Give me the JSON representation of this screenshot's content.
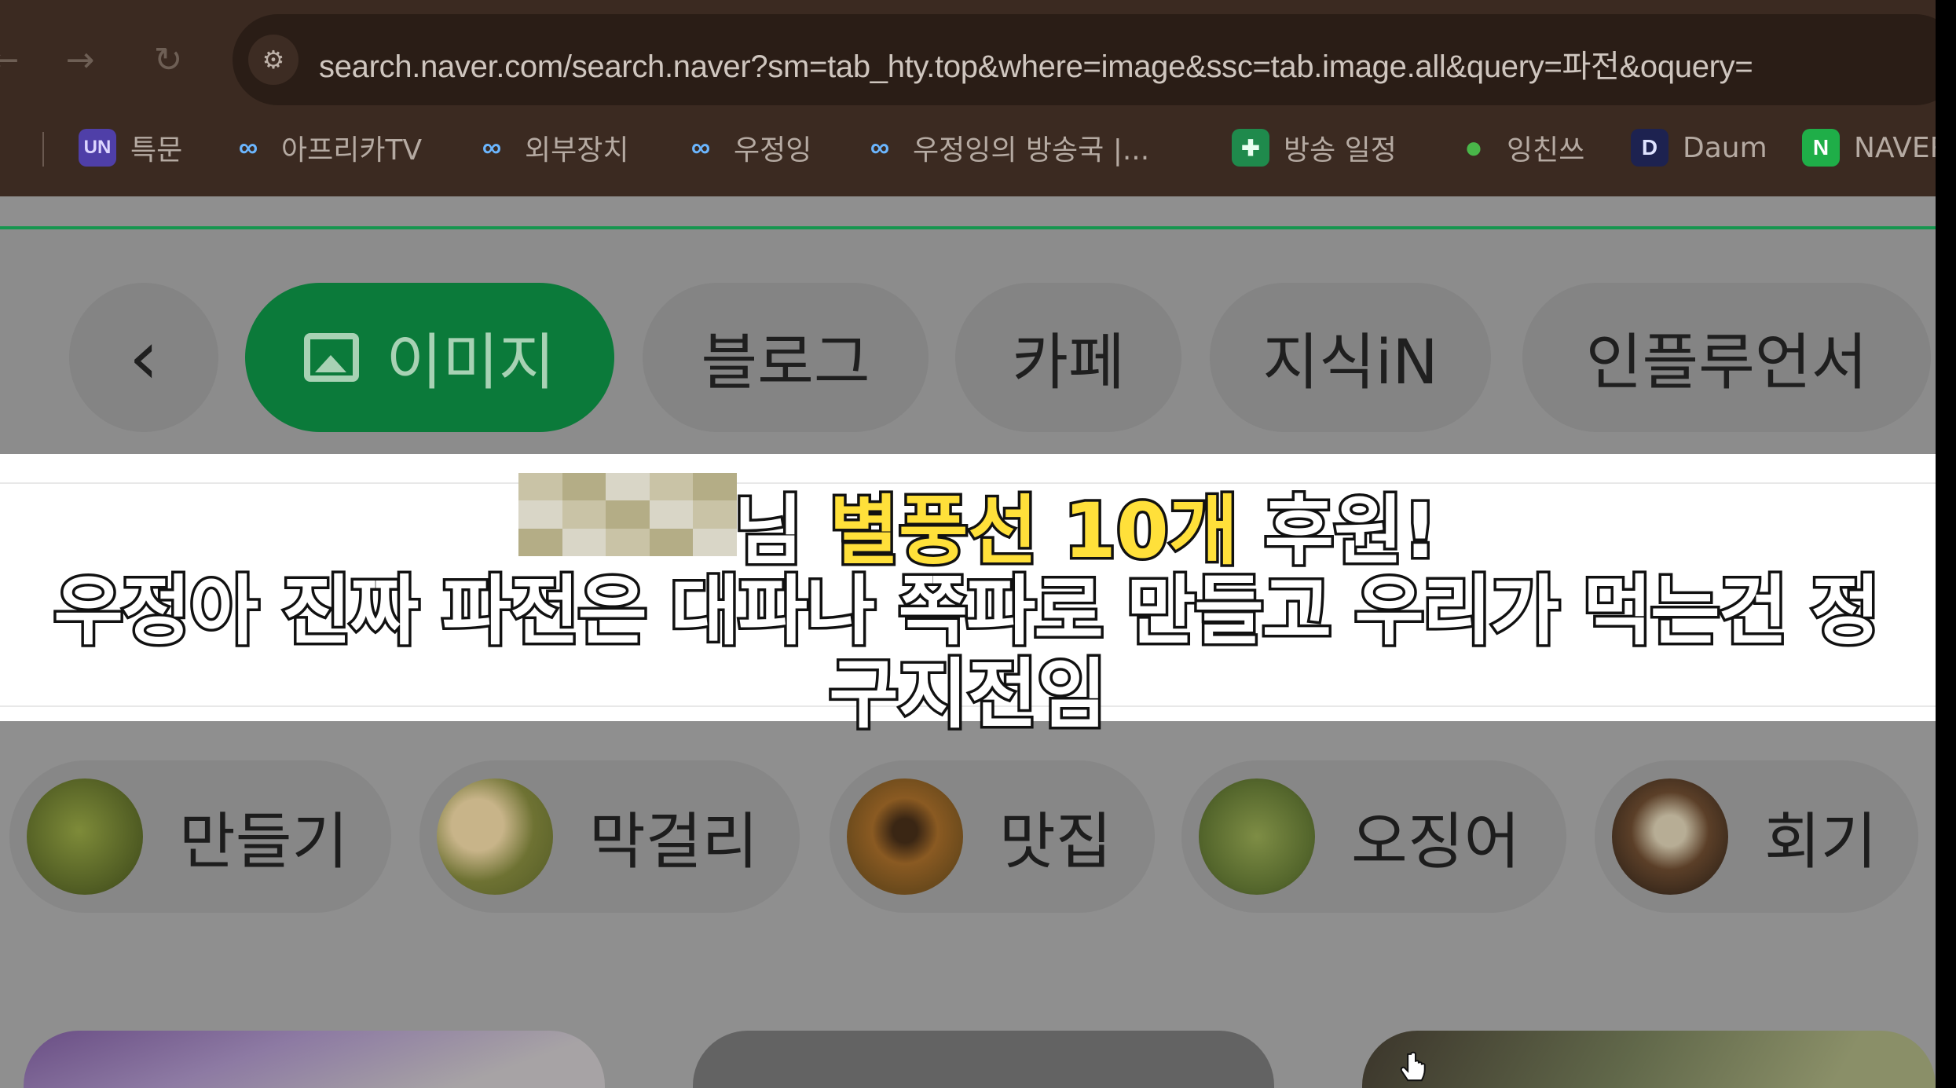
{
  "browser": {
    "url": "search.naver.com/search.naver?sm=tab_hty.top&where=image&ssc=tab.image.all&query=파전&oquery=",
    "bookmarks": [
      {
        "label": "특문",
        "icon": "UN"
      },
      {
        "label": "아프리카TV",
        "icon": "afreecatv-icon"
      },
      {
        "label": "외부장치",
        "icon": "afreecatv-icon"
      },
      {
        "label": "우정잉",
        "icon": "afreecatv-icon"
      },
      {
        "label": "우정잉의 방송국 |...",
        "icon": "afreecatv-icon"
      },
      {
        "label": "방송 일정",
        "icon": "sheets-plus-icon"
      },
      {
        "label": "잉친쓰",
        "icon": "leaf-icon"
      },
      {
        "label": "Daum",
        "icon": "D"
      },
      {
        "label": "NAVER",
        "icon": "N"
      }
    ]
  },
  "tabs": {
    "back": "‹",
    "items": [
      "이미지",
      "블로그",
      "카페",
      "지식iN",
      "인플루언서"
    ],
    "active": "이미지"
  },
  "caption": {
    "donor_suffix": "님",
    "highlight": "별풍선 10개",
    "tail": "후원!",
    "line2": "우정아 진짜 파전은 대파나 쪽파로 만들고 우리가 먹는건 정",
    "line3": "구지전임"
  },
  "related": [
    "만들기",
    "막걸리",
    "맛집",
    "오징어",
    "회기"
  ],
  "colors": {
    "accent_green": "#03C75A",
    "highlight_yellow": "#FFE03A"
  }
}
